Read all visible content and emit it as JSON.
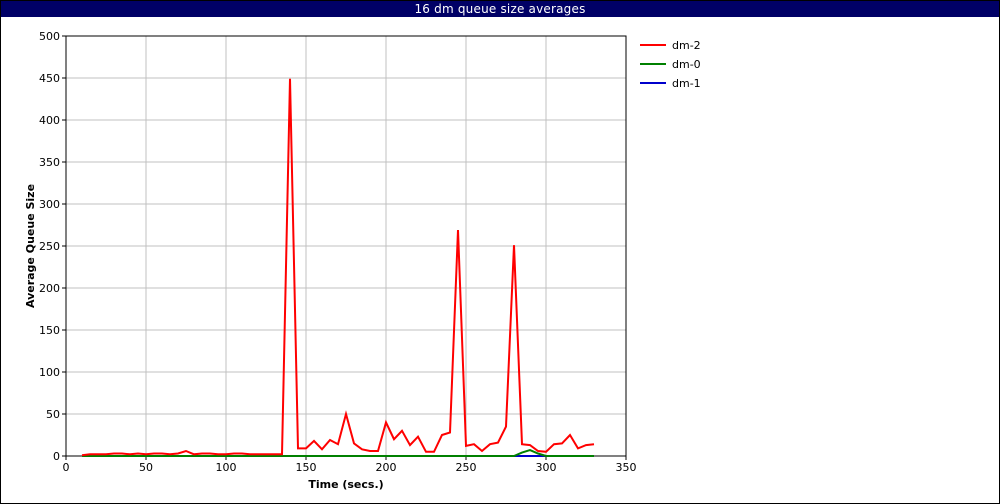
{
  "window": {
    "title": "16 dm queue size averages"
  },
  "colors": {
    "title_bar": "#000066",
    "grid": "#c0c0c0",
    "axis": "#000000"
  },
  "chart_data": {
    "type": "line",
    "title": "16 dm queue size averages",
    "xlabel": "Time (secs.)",
    "ylabel": "Average Queue Size",
    "xlim": [
      0,
      350
    ],
    "ylim": [
      0,
      500
    ],
    "x_ticks": [
      0,
      50,
      100,
      150,
      200,
      250,
      300,
      350
    ],
    "y_ticks": [
      0,
      50,
      100,
      150,
      200,
      250,
      300,
      350,
      400,
      450,
      500
    ],
    "grid": true,
    "legend_position": "right",
    "series": [
      {
        "name": "dm-2",
        "color": "#ff0000",
        "x": [
          10,
          15,
          20,
          25,
          30,
          35,
          40,
          45,
          50,
          55,
          60,
          65,
          70,
          75,
          80,
          85,
          90,
          95,
          100,
          105,
          110,
          115,
          120,
          125,
          130,
          135,
          140,
          145,
          150,
          155,
          160,
          165,
          170,
          175,
          180,
          185,
          190,
          195,
          200,
          205,
          210,
          215,
          220,
          225,
          230,
          235,
          240,
          245,
          250,
          255,
          260,
          265,
          270,
          275,
          280,
          285,
          290,
          295,
          300,
          305,
          310,
          315,
          320,
          325,
          330
        ],
        "y": [
          1,
          2,
          2,
          2,
          3,
          3,
          2,
          3,
          2,
          3,
          3,
          2,
          3,
          6,
          2,
          3,
          3,
          2,
          2,
          3,
          3,
          2,
          2,
          2,
          2,
          2,
          449,
          9,
          9,
          18,
          8,
          19,
          14,
          50,
          15,
          8,
          6,
          6,
          40,
          20,
          30,
          13,
          23,
          5,
          5,
          25,
          28,
          269,
          12,
          14,
          6,
          14,
          16,
          35,
          251,
          14,
          13,
          6,
          5,
          14,
          15,
          25,
          9,
          13,
          14
        ]
      },
      {
        "name": "dm-0",
        "color": "#008000",
        "x": [
          10,
          50,
          100,
          150,
          200,
          250,
          280,
          285,
          290,
          295,
          300,
          310,
          320,
          330
        ],
        "y": [
          0,
          0,
          0,
          0,
          0,
          0,
          0,
          4,
          7,
          3,
          0,
          0,
          0,
          0
        ]
      },
      {
        "name": "dm-1",
        "color": "#0000cc",
        "x": [
          10,
          50,
          100,
          150,
          200,
          250,
          290,
          300,
          310,
          320,
          330
        ],
        "y": [
          0,
          0,
          0,
          0,
          0,
          0,
          0,
          0,
          0,
          0,
          0
        ]
      }
    ]
  }
}
